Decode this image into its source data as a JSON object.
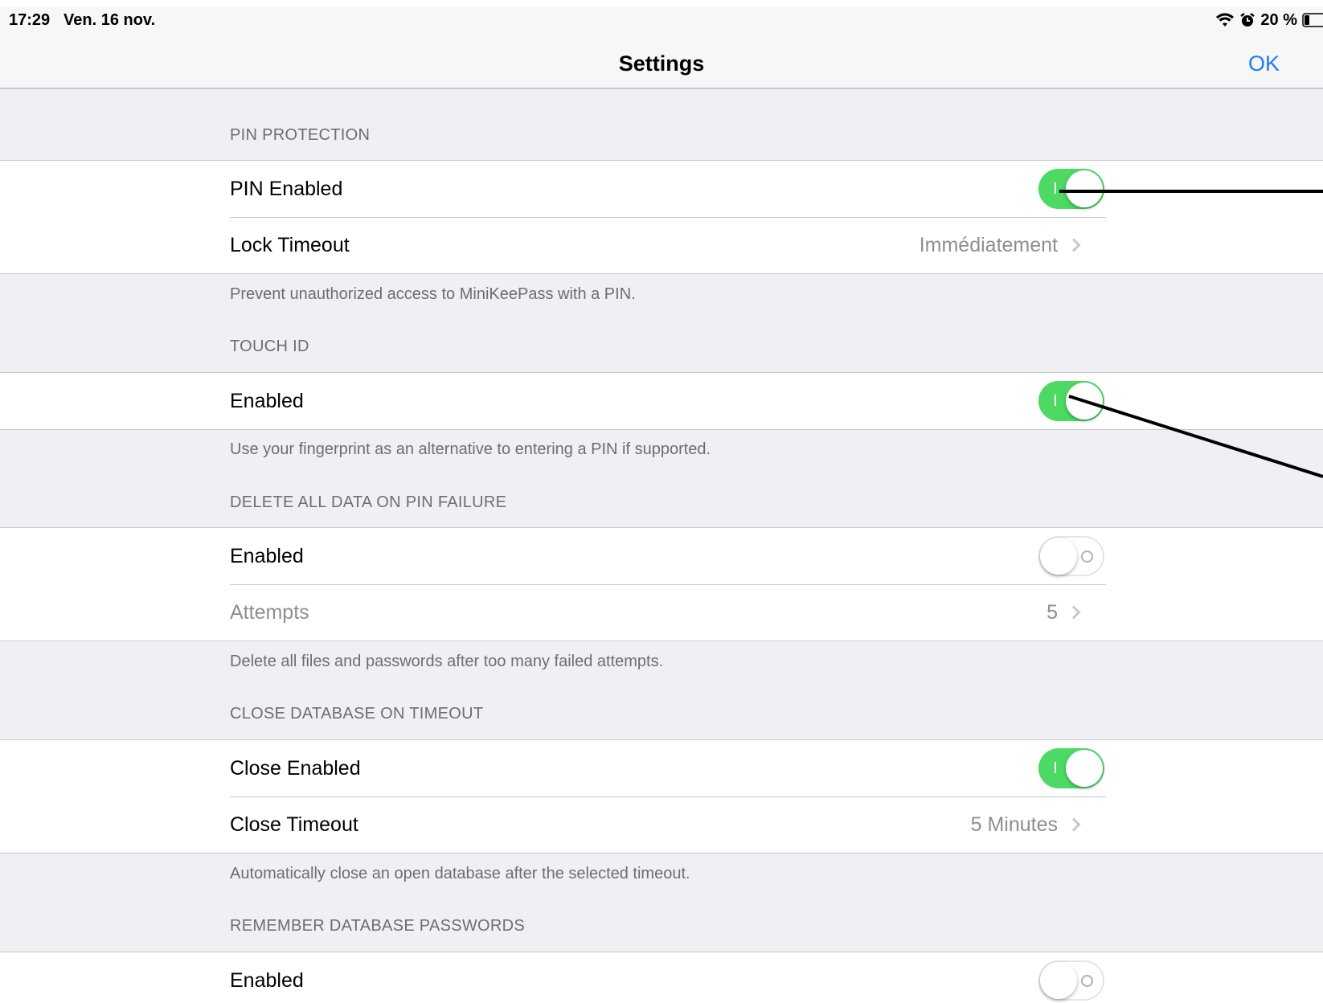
{
  "status_bar": {
    "time": "17:29",
    "date": "Ven. 16 nov.",
    "battery_text": "20 %",
    "icons": [
      "wifi-icon",
      "alarm-icon",
      "battery-icon"
    ]
  },
  "nav": {
    "title": "Settings",
    "ok_label": "OK"
  },
  "sections": {
    "pin": {
      "header": "PIN PROTECTION",
      "pin_enabled_label": "PIN Enabled",
      "pin_enabled_on": true,
      "lock_timeout_label": "Lock Timeout",
      "lock_timeout_value": "Immédiatement",
      "footer": "Prevent unauthorized access to MiniKeePass with a PIN."
    },
    "touch_id": {
      "header": "TOUCH ID",
      "enabled_label": "Enabled",
      "enabled_on": true,
      "footer": "Use your fingerprint as an alternative to entering a PIN if supported."
    },
    "delete_data": {
      "header": "DELETE ALL DATA ON PIN FAILURE",
      "enabled_label": "Enabled",
      "enabled_on": false,
      "attempts_label": "Attempts",
      "attempts_value": "5",
      "footer": "Delete all files and passwords after too many failed attempts."
    },
    "close_db": {
      "header": "CLOSE DATABASE ON TIMEOUT",
      "close_enabled_label": "Close Enabled",
      "close_enabled_on": true,
      "close_timeout_label": "Close Timeout",
      "close_timeout_value": "5 Minutes",
      "footer": "Automatically close an open database after the selected timeout."
    },
    "remember_pw": {
      "header": "REMEMBER DATABASE PASSWORDS",
      "enabled_label": "Enabled",
      "enabled_on": false
    }
  },
  "colors": {
    "accent": "#157efb",
    "switch_on": "#4cd964",
    "group_background": "#efeff4"
  }
}
